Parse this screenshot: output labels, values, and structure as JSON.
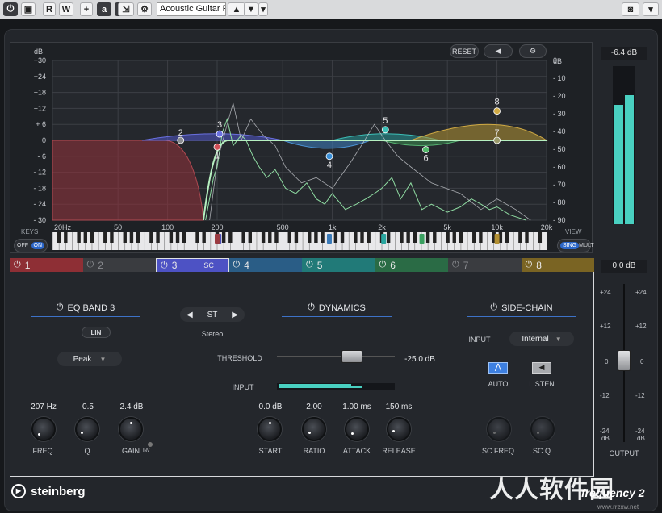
{
  "toolbar": {
    "power_icon": "power-icon",
    "compare_icon": "compare-icon",
    "read": "R",
    "write": "W",
    "preset_name": "Acoustic Guitar Ro",
    "camera_icon": "camera-icon"
  },
  "graph": {
    "left_unit": "dB",
    "right_unit": "dB",
    "left_ticks": [
      "+30",
      "+24",
      "+18",
      "+12",
      "+ 6",
      "0",
      "- 6",
      "- 12",
      "- 18",
      "- 24",
      "- 30"
    ],
    "right_ticks": [
      "0",
      "- 10",
      "- 20",
      "- 30",
      "- 40",
      "- 50",
      "- 60",
      "- 70",
      "- 80",
      "- 90"
    ],
    "freq_ticks": [
      "20Hz",
      "50",
      "100",
      "200",
      "500",
      "1k",
      "2k",
      "5k",
      "10k",
      "20k"
    ],
    "reset": "RESET",
    "keys": "KEYS",
    "off": "OFF",
    "on": "ON",
    "view": "VIEW",
    "sing": "SING",
    "mult": "MULT",
    "node_labels": [
      "1",
      "2",
      "3",
      "4",
      "5",
      "6",
      "7",
      "8"
    ]
  },
  "bands": [
    {
      "num": "1",
      "color": "#8e2f35"
    },
    {
      "num": "2",
      "color": "#3a3c40"
    },
    {
      "num": "3",
      "sc": "SC",
      "color": "#4a4fb8"
    },
    {
      "num": "4",
      "color": "#2a5d86"
    },
    {
      "num": "5",
      "color": "#217a78"
    },
    {
      "num": "6",
      "color": "#2a6b45"
    },
    {
      "num": "7",
      "color": "#3a3c40"
    },
    {
      "num": "8",
      "color": "#7a6423"
    }
  ],
  "eq_band": {
    "title": "EQ BAND 3",
    "lin": "LIN",
    "filter_type": "Peak",
    "freq": "207 Hz",
    "q": "0.5",
    "gain": "2.4 dB",
    "freq_label": "FREQ",
    "q_label": "Q",
    "gain_label": "GAIN",
    "inv": "INV"
  },
  "channel": {
    "mode": "ST",
    "mode_label": "Stereo"
  },
  "dynamics": {
    "title": "DYNAMICS",
    "threshold_label": "THRESHOLD",
    "threshold": "-25.0 dB",
    "input_label": "INPUT",
    "start": "0.0 dB",
    "ratio": "2.00",
    "attack": "1.00 ms",
    "release": "150 ms",
    "start_label": "START",
    "ratio_label": "RATIO",
    "attack_label": "ATTACK",
    "release_label": "RELEASE"
  },
  "sidechain": {
    "title": "SIDE-CHAIN",
    "input_label": "INPUT",
    "input": "Internal",
    "auto": "AUTO",
    "listen": "LISTEN",
    "sc_freq": "SC FREQ",
    "sc_q": "SC Q"
  },
  "output": {
    "peak": "-6.4 dB",
    "gain": "0.0 dB",
    "label": "OUTPUT",
    "scale": [
      "+24",
      "+12",
      "0",
      "-12",
      "-24"
    ],
    "db": "dB",
    "meter_left": 0.78,
    "meter_right": 0.84
  },
  "brand": {
    "name": "steinberg",
    "product": "frequency 2"
  },
  "watermark": {
    "text": "人人软件园",
    "url": "www.rrzxw.net"
  }
}
